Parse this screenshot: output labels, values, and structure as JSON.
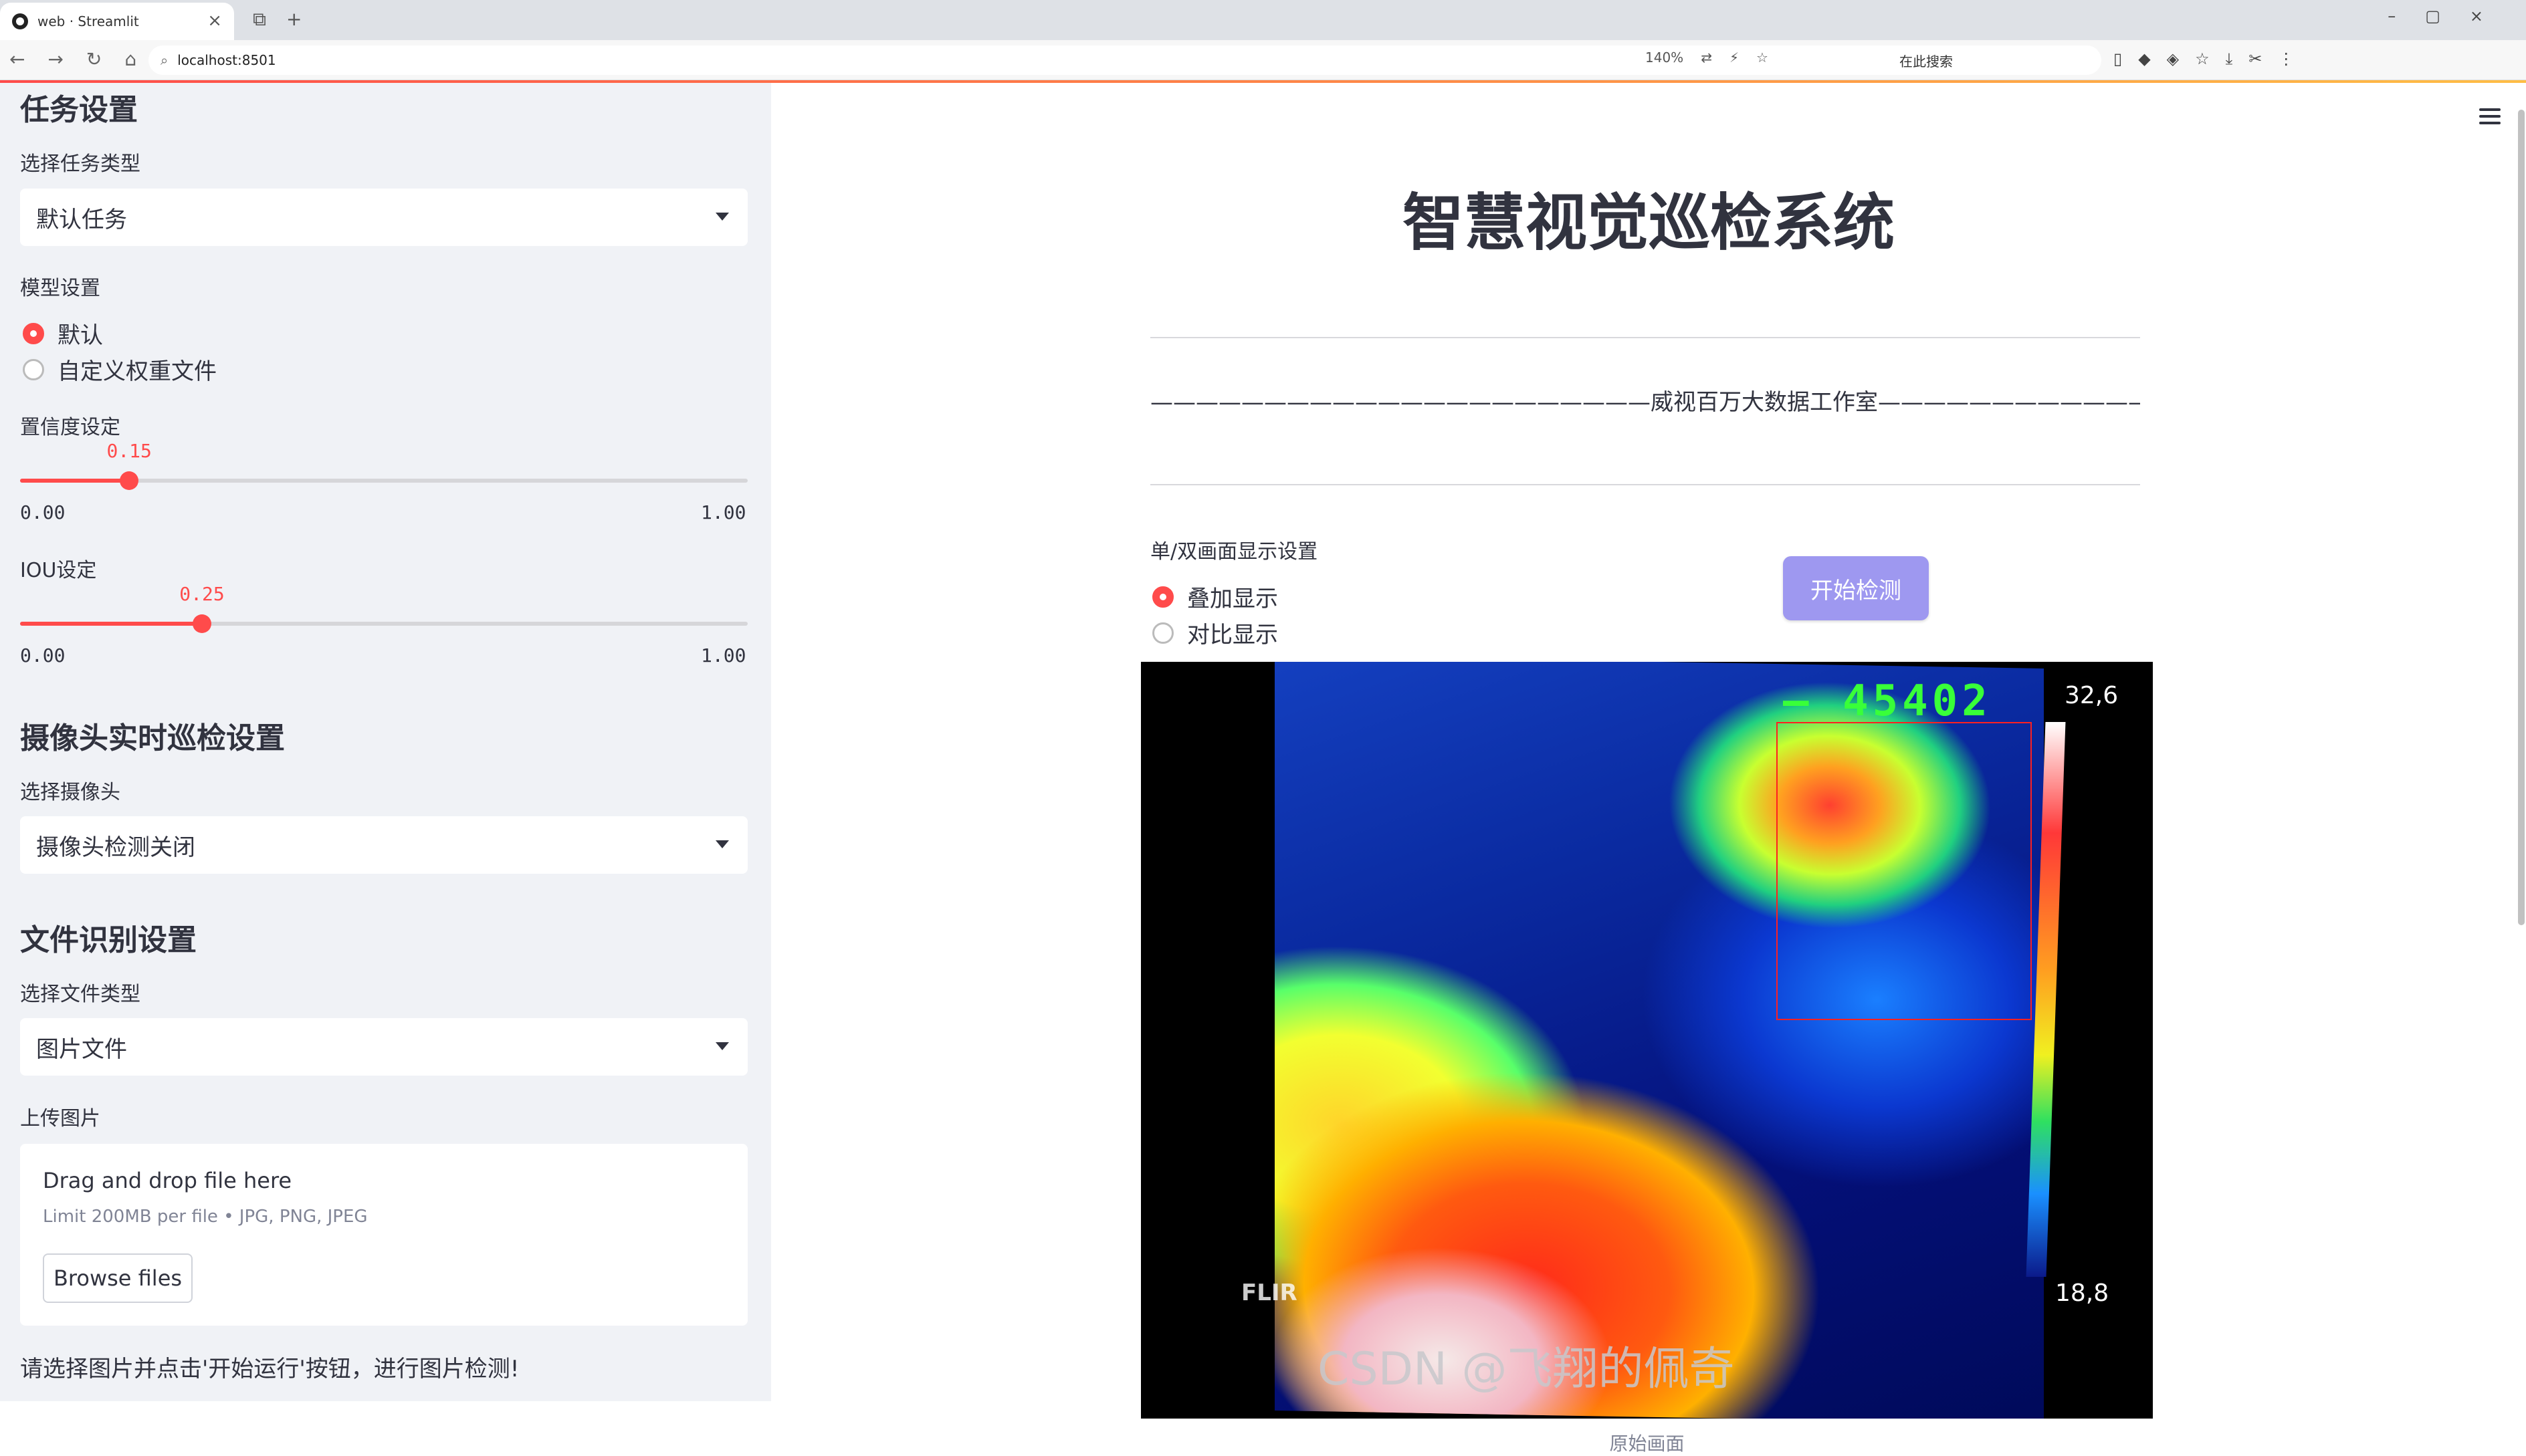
{
  "browser": {
    "tab_title": "web · Streamlit",
    "url": "localhost:8501",
    "zoom": "140%",
    "search_placeholder": "在此搜索"
  },
  "sidebar": {
    "task_settings_header": "任务设置",
    "task_type_label": "选择任务类型",
    "task_type_value": "默认任务",
    "model_settings_label": "模型设置",
    "model_options": [
      "默认",
      "自定义权重文件"
    ],
    "model_selected": "默认",
    "confidence_label": "置信度设定",
    "confidence_value": "0.15",
    "confidence_min": "0.00",
    "confidence_max": "1.00",
    "iou_label": "IOU设定",
    "iou_value": "0.25",
    "iou_min": "0.00",
    "iou_max": "1.00",
    "camera_header": "摄像头实时巡检设置",
    "camera_label": "选择摄像头",
    "camera_value": "摄像头检测关闭",
    "file_header": "文件识别设置",
    "file_type_label": "选择文件类型",
    "file_type_value": "图片文件",
    "upload_label": "上传图片",
    "upload_title": "Drag and drop file here",
    "upload_limit": "Limit 200MB per file • JPG, PNG, JPEG",
    "browse_button": "Browse files",
    "note": "请选择图片并点击'开始运行'按钮，进行图片检测!"
  },
  "main": {
    "title": "智慧视觉巡检系统",
    "subtitle": "——————————————————————威视百万大数据工作室————————————————————————",
    "display_label": "单/双画面显示设置",
    "display_options": [
      "叠加显示",
      "对比显示"
    ],
    "display_selected": "叠加显示",
    "start_button": "开始检测",
    "image": {
      "overlay_number": "— 45402",
      "temp_max": "32,6",
      "temp_min": "18,8",
      "brand": "FLIR"
    },
    "caption": "原始画面",
    "watermark": "CSDN @飞翔的佩奇"
  },
  "colors": {
    "accent": "#ff4b4b",
    "sidebar_bg": "#f0f2f6",
    "button_bg": "#9e98f0"
  }
}
